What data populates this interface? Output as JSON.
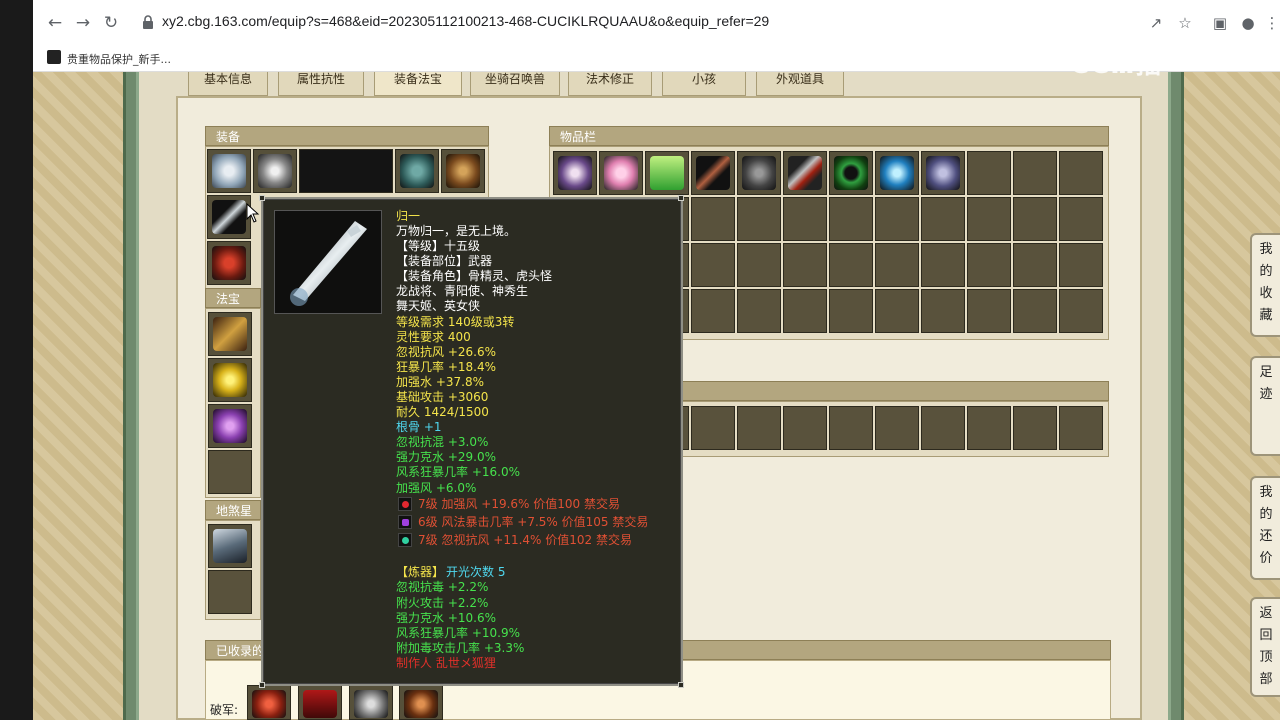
{
  "browser": {
    "url": "xy2.cbg.163.com/equip?s=468&eid=202305112100213-468-CUCIKLRQUAAU&o&equip_refer=29",
    "bookmark": "贵重物品保护_新手..."
  },
  "watermark": "CCⅢ播",
  "tabs": [
    "基本信息",
    "属性抗性",
    "装备法宝",
    "坐骑召唤兽",
    "法术修正",
    "小孩",
    "外观道具"
  ],
  "sections": {
    "equipment": "装备",
    "fabao": "法宝",
    "lingbao": "地煞星阵",
    "inventory": "物品栏",
    "recorded": "已收录的",
    "pojun_label": "破军:"
  },
  "tooltip": {
    "name": "归一",
    "desc": "万物归一，是无上境。",
    "level": "【等级】十五级",
    "part": "【装备部位】武器",
    "roles1": "【装备角色】骨精灵、虎头怪",
    "roles2": "龙战将、青阳使、神秀生",
    "roles3": "舞天姬、英女侠",
    "req_level": "等级需求 140级或3转",
    "req_ling": "灵性要求 400",
    "attr1": "忽视抗风 +26.6%",
    "attr2": "狂暴几率 +18.4%",
    "attr3": "加强水 +37.8%",
    "attr4": "基础攻击 +3060",
    "durability": "耐久 1424/1500",
    "gengu": "根骨 +1",
    "ex1": "忽视抗混 +3.0%",
    "ex2": "强力克水 +29.0%",
    "ex3": "风系狂暴几率 +16.0%",
    "ex4": "加强风 +6.0%",
    "gem1": "7级 加强风 +19.6% 价值100 禁交易",
    "gem2": "6级 风法暴击几率 +7.5% 价值105 禁交易",
    "gem3": "7级 忽视抗风 +11.4% 价值102 禁交易",
    "lianqi_label": "【炼器】",
    "lianqi_value": "开光次数 5",
    "lq1": "忽视抗毒 +2.2%",
    "lq2": "附火攻击 +2.2%",
    "lq3": "强力克水 +10.6%",
    "lq4": "风系狂暴几率 +10.9%",
    "lq5": "附加毒攻击几率 +3.3%",
    "maker": "制作人 乱世メ狐狸"
  },
  "side_buttons": [
    "我的收藏",
    "足迹",
    "我的还价",
    "返回顶部"
  ],
  "colors": {
    "gold_text": "#f4e44b",
    "green_text": "#46e24d",
    "cyan_text": "#4fd7ee",
    "red_text": "#e05034"
  }
}
